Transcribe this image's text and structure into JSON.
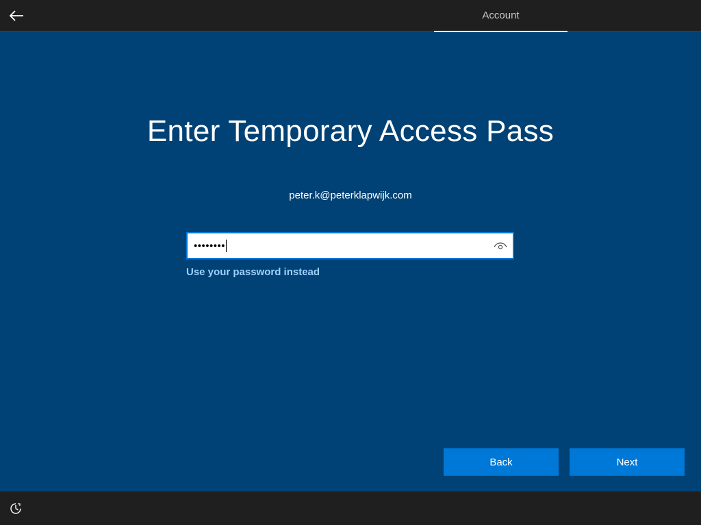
{
  "topbar": {
    "tab_label": "Account"
  },
  "icons": {
    "back": "back-arrow-icon",
    "reveal": "eye-icon",
    "ease_of_access": "ease-of-access-icon"
  },
  "main": {
    "title": "Enter Temporary Access Pass",
    "email": "peter.k@peterklapwijk.com",
    "password_masked": "••••••••",
    "alt_link": "Use your password instead"
  },
  "buttons": {
    "back_label": "Back",
    "next_label": "Next"
  },
  "colors": {
    "background": "#004275",
    "bar": "#1f1f1f",
    "accent": "#0078d7",
    "link": "#9fd1ff"
  }
}
